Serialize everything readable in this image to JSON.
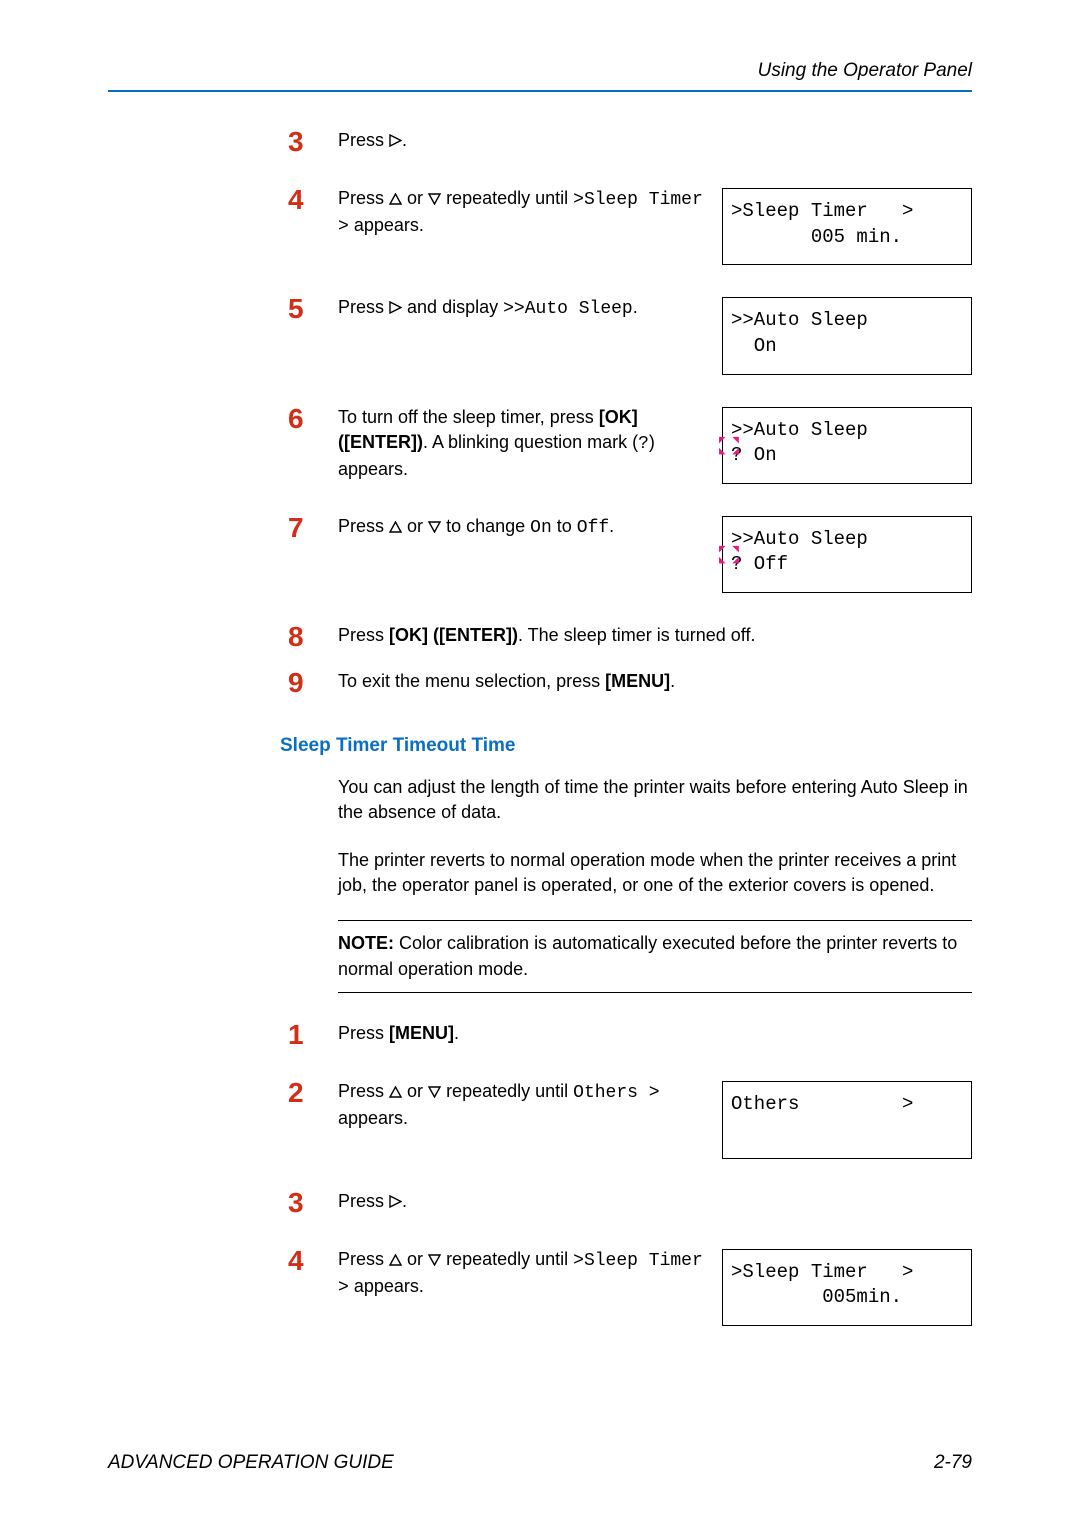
{
  "header": "Using the Operator Panel",
  "stepsA": {
    "3": {
      "text": "Press ▷."
    },
    "4": {
      "part1": "Press ",
      "part2": " or ",
      "part3": " repeatedly until ",
      "mono1": ">Sleep Timer >",
      "part4": " appears.",
      "lcd1": ">Sleep Timer   >",
      "lcd2": "       005 min."
    },
    "5": {
      "part1": "Press ",
      "part2": " and display ",
      "mono1": ">>Auto Sleep",
      "part3": ".",
      "lcd1": ">>Auto Sleep",
      "lcd2": "  On"
    },
    "6": {
      "part1": "To turn off the sleep timer, press ",
      "bold1": "[OK]",
      "part2": " ",
      "bold2": "([ENTER])",
      "part3": ". A blinking question mark (",
      "mono1": "?",
      "part4": ") appears.",
      "lcd1": ">>Auto Sleep",
      "lcd2": "? On"
    },
    "7": {
      "part1": "Press ",
      "part2": " or ",
      "part3": " to change ",
      "mono1": "On",
      "part4": " to ",
      "mono2": "Off",
      "part5": ".",
      "lcd1": ">>Auto Sleep",
      "lcd2": "? Off"
    },
    "8": {
      "part1": "Press ",
      "bold1": "[OK] ([ENTER])",
      "part2": ". The sleep timer is turned off."
    },
    "9": {
      "part1": "To exit the menu selection, press ",
      "bold1": "[MENU]",
      "part2": "."
    }
  },
  "section_heading": "Sleep Timer Timeout Time",
  "body1": "You can adjust the length of time the printer waits before entering Auto Sleep in the absence of data.",
  "body2": "The printer reverts to normal operation mode when the printer receives a print job, the operator panel is operated, or one of the exterior covers is opened.",
  "note": {
    "label": "NOTE:",
    "text": " Color calibration is automatically executed before the printer reverts to normal operation mode."
  },
  "stepsB": {
    "1": {
      "part1": "Press ",
      "bold1": "[MENU]",
      "part2": "."
    },
    "2": {
      "part1": "Press ",
      "part2": " or ",
      "part3": " repeatedly until ",
      "mono1": "Others >",
      "part4": " appears.",
      "lcd1": "Others         >",
      "lcd2": " "
    },
    "3": {
      "text": "Press ▷."
    },
    "4": {
      "part1": "Press ",
      "part2": " or ",
      "part3": " repeatedly until ",
      "mono1": ">Sleep Timer >",
      "part4": " appears.",
      "lcd1": ">Sleep Timer   >",
      "lcd2": "        005min."
    }
  },
  "footer_left": "ADVANCED OPERATION GUIDE",
  "footer_right": "2-79"
}
